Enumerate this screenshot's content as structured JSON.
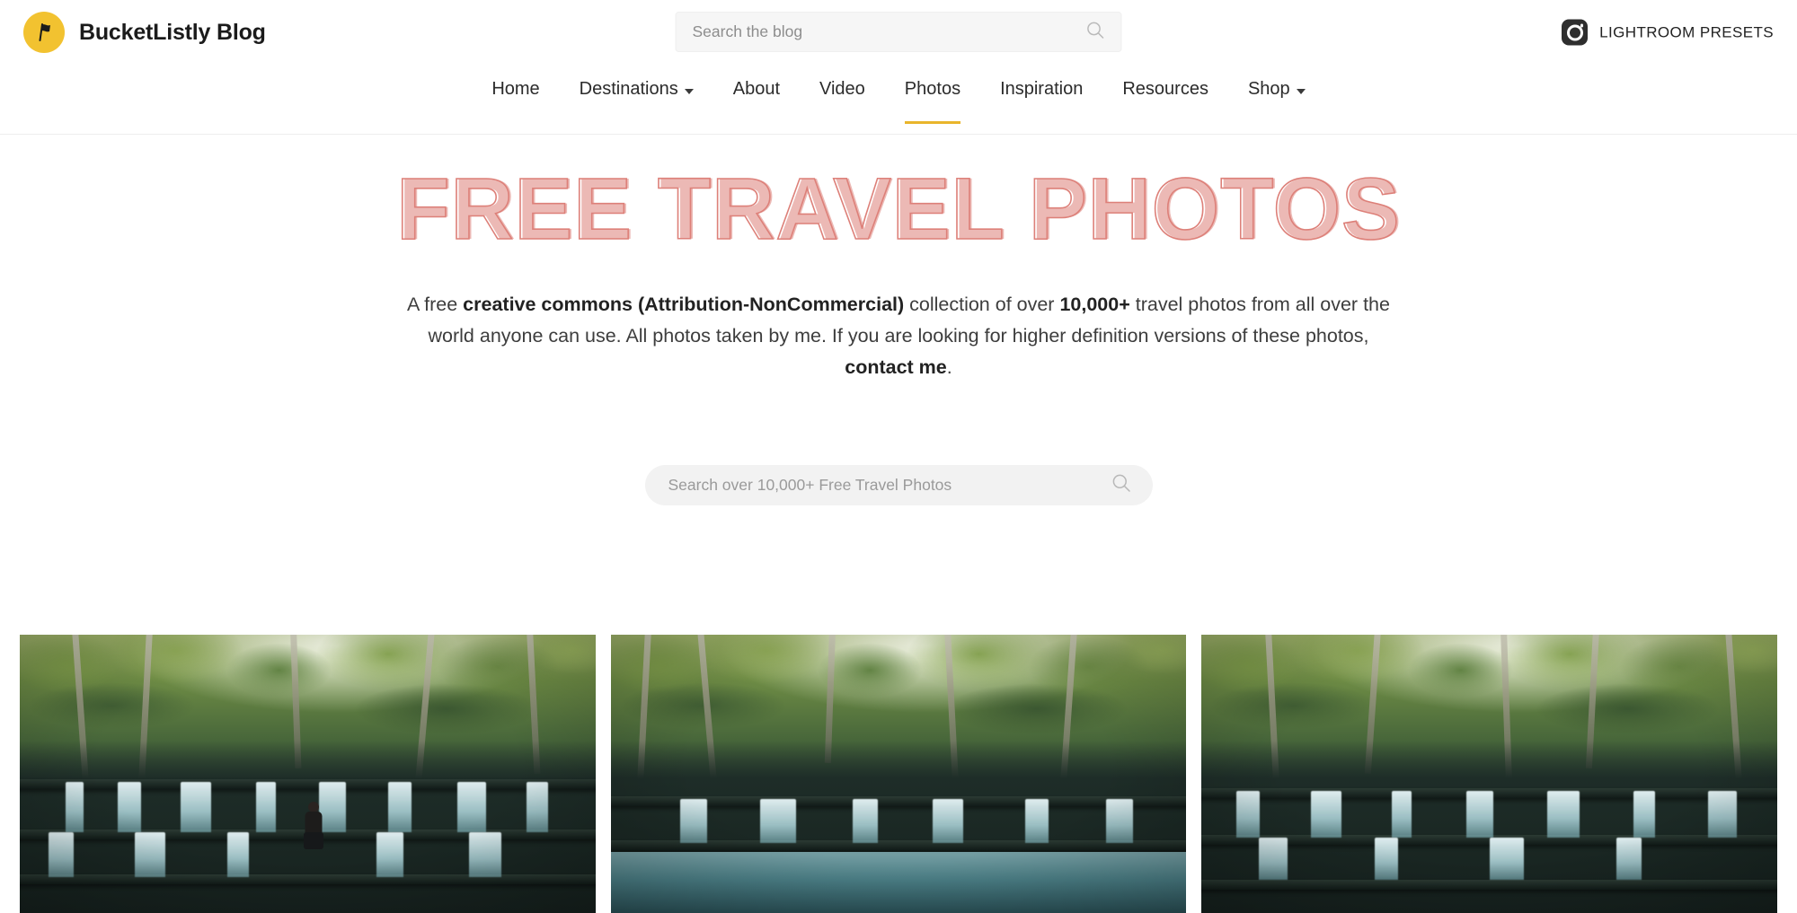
{
  "header": {
    "brand_name": "BucketListly Blog",
    "logo_icon": "flag-icon",
    "logo_color": "#F2C230",
    "search": {
      "placeholder": "Search the blog",
      "value": "",
      "icon": "search-icon"
    },
    "presets_link": {
      "label": "LIGHTROOM PRESETS",
      "icon": "instagram-camera-icon"
    }
  },
  "nav": {
    "active": "Photos",
    "active_underline_color": "#E9B52B",
    "items": [
      {
        "label": "Home",
        "has_dropdown": false
      },
      {
        "label": "Destinations",
        "has_dropdown": true
      },
      {
        "label": "About",
        "has_dropdown": false
      },
      {
        "label": "Video",
        "has_dropdown": false
      },
      {
        "label": "Photos",
        "has_dropdown": false
      },
      {
        "label": "Inspiration",
        "has_dropdown": false
      },
      {
        "label": "Resources",
        "has_dropdown": false
      },
      {
        "label": "Shop",
        "has_dropdown": true
      }
    ]
  },
  "hero": {
    "title": "FREE TRAVEL PHOTOS",
    "title_outline_color": "#dd8079",
    "description": {
      "part1": "A free ",
      "bold1": "creative commons (Attribution-NonCommercial)",
      "part2": " collection of over ",
      "bold2": "10,000+",
      "part3": " travel photos from all over the world anyone can use. All photos taken by me. If you are looking for higher definition versions of these photos, ",
      "bold3": "contact me",
      "part4": "."
    }
  },
  "photo_search": {
    "placeholder": "Search over 10,000+ Free Travel Photos",
    "value": "",
    "icon": "search-icon"
  },
  "photo_grid": {
    "items": [
      {
        "alt": "Cascading waterfall in green forest with person sitting on rocks"
      },
      {
        "alt": "Tiered waterfall flowing into a calm pool in lush jungle"
      },
      {
        "alt": "Wide rocky waterfall surrounded by dense tropical trees"
      }
    ]
  }
}
